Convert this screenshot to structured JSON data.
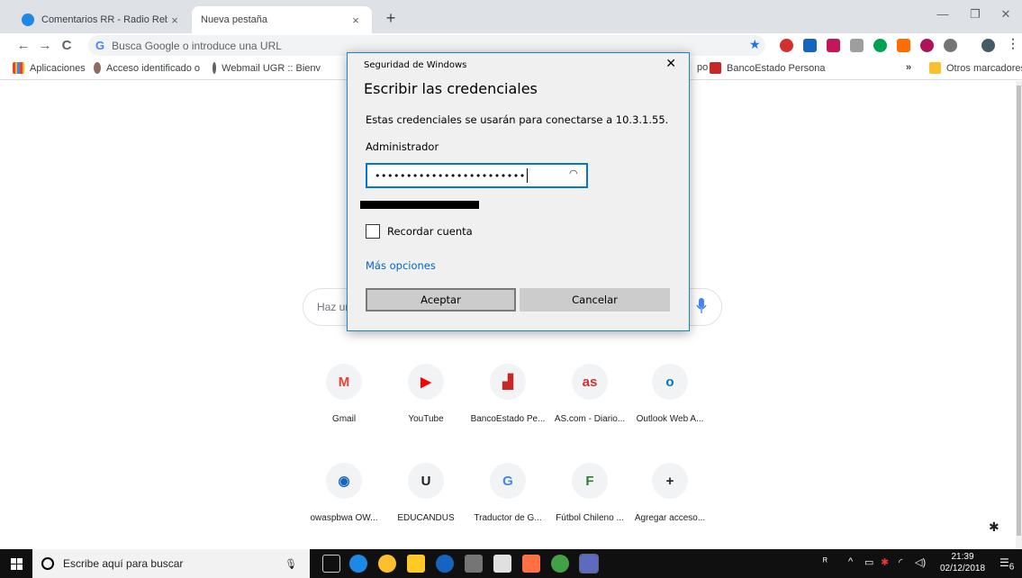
{
  "browser": {
    "tabs": [
      {
        "label": "Comentarios RR - Radio Rebelde.",
        "active": false
      },
      {
        "label": "Nueva pestaña",
        "active": true
      }
    ],
    "tab_close_glyph": "×",
    "new_tab_glyph": "+",
    "window_controls": [
      "—",
      "❐",
      "✕"
    ],
    "omnibox_placeholder": "Busca Google o introduce una URL",
    "omnibox_logo": "G",
    "bookmarks": [
      {
        "label": "Aplicaciones",
        "icon": "apps-grid-icon"
      },
      {
        "label": "Acceso identificado o",
        "icon": "university-icon"
      },
      {
        "label": "Webmail UGR :: Bienv",
        "icon": "webmail-icon"
      },
      {
        "label": "po",
        "icon": ""
      },
      {
        "label": "BancoEstado Persona",
        "icon": "bancoestado-icon"
      }
    ],
    "bookmarks_overflow": "»",
    "other_bookmarks": "Otros marcadores"
  },
  "newtab": {
    "search_placeholder": "Haz ur",
    "shortcuts_row1": [
      {
        "label": "Gmail",
        "glyph": "M",
        "color": "#ea4335"
      },
      {
        "label": "YouTube",
        "glyph": "▶",
        "color": "#ff0000"
      },
      {
        "label": "BancoEstado Pe...",
        "glyph": "▟",
        "color": "#c62828"
      },
      {
        "label": "AS.com - Diario...",
        "glyph": "as",
        "color": "#d32f2f"
      },
      {
        "label": "Outlook Web A...",
        "glyph": "o",
        "color": "#0072c6"
      }
    ],
    "shortcuts_row2": [
      {
        "label": "owaspbwa OW...",
        "glyph": "◉",
        "color": "#1565c0"
      },
      {
        "label": "EDUCANDUS",
        "glyph": "U",
        "color": "#212121"
      },
      {
        "label": "Traductor de G...",
        "glyph": "G",
        "color": "#4285f4"
      },
      {
        "label": "Fútbol Chileno ...",
        "glyph": "F",
        "color": "#2e7d32"
      },
      {
        "label": "Agregar acceso...",
        "glyph": "+",
        "color": "#202124"
      }
    ]
  },
  "dialog": {
    "header": "Seguridad de Windows",
    "close_glyph": "✕",
    "title": "Escribir las credenciales",
    "description": "Estas credenciales se usarán para conectarse a 10.3.1.55.",
    "username": "Administrador",
    "password_mask": "••••••••••••••••••••••••",
    "remember_label": "Recordar cuenta",
    "more_options": "Más opciones",
    "ok_label": "Aceptar",
    "cancel_label": "Cancelar"
  },
  "taskbar": {
    "search_placeholder": "Escribe aquí para buscar",
    "time": "21:39",
    "date": "02/12/2018",
    "notifications_count": "6"
  }
}
